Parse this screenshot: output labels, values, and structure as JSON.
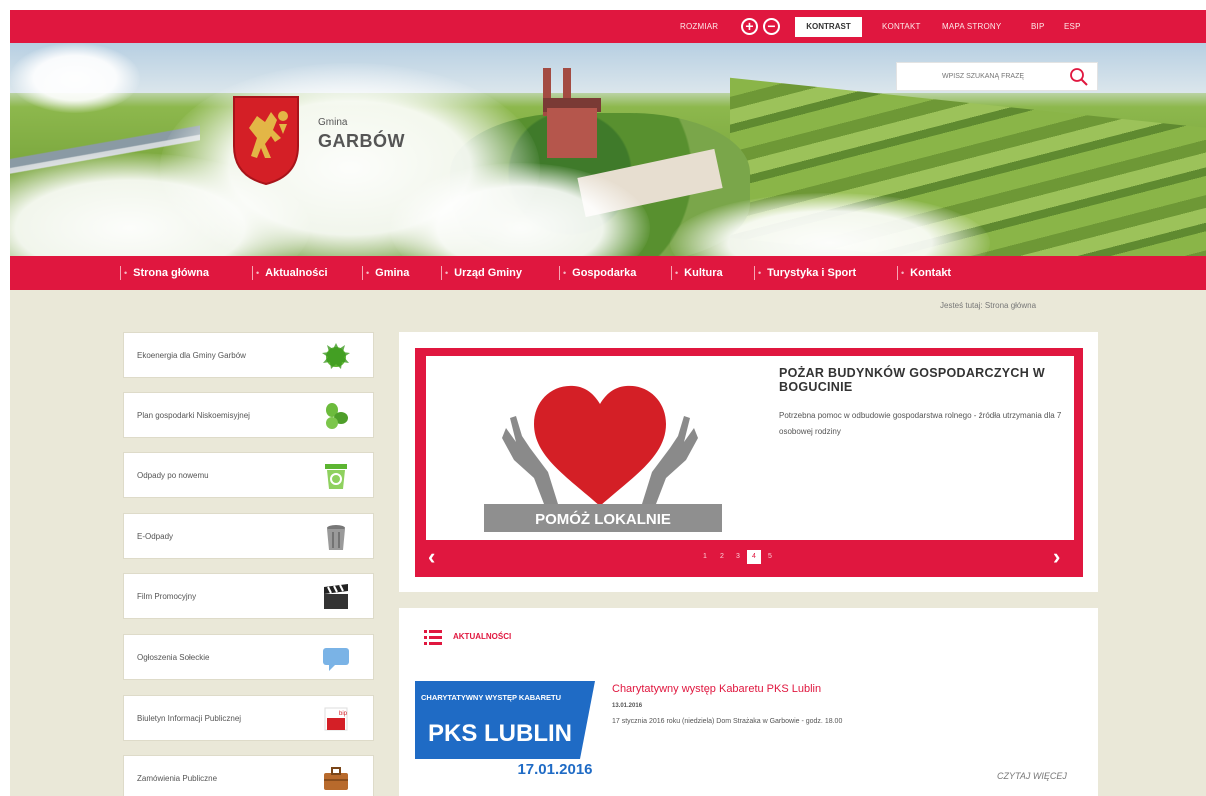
{
  "topbar": {
    "links": [
      "ROZMIAR",
      "KONTRAST",
      "KONTAKT",
      "MAPA STRONY",
      "BIP",
      "ESP"
    ]
  },
  "header": {
    "gmina_label": "Gmina",
    "gmina_name": "GARBÓW",
    "search_placeholder": "WPISZ SZUKANĄ FRAZĘ"
  },
  "nav": {
    "items": [
      "Strona główna",
      "Aktualności",
      "Gmina",
      "Urząd Gminy",
      "Gospodarka",
      "Kultura",
      "Turystyka i Sport",
      "Kontakt"
    ]
  },
  "breadcrumb": "Jesteś tutaj: Strona główna",
  "sidebar": {
    "items": [
      {
        "label": "Ekoenergia dla Gminy Garbów",
        "icon": "eco-globe-icon"
      },
      {
        "label": "Plan gospodarki Niskoemisyjnej",
        "icon": "leaves-icon"
      },
      {
        "label": "Odpady po nowemu",
        "icon": "recycle-bin-icon"
      },
      {
        "label": "E-Odpady",
        "icon": "trash-can-icon"
      },
      {
        "label": "Film Promocyjny",
        "icon": "clapperboard-icon"
      },
      {
        "label": "Ogłoszenia Sołeckie",
        "icon": "speech-bubble-icon"
      },
      {
        "label": "Biuletyn Informacji Publicznej",
        "icon": "bip-icon"
      },
      {
        "label": "Zamówienia Publiczne",
        "icon": "briefcase-icon"
      }
    ]
  },
  "slider": {
    "image_caption": "POMÓŻ LOKALNIE",
    "title": "POŻAR BUDYNKÓW GOSPODARCZYCH W BOGUCINIE",
    "description": "Potrzebna pomoc w odbudowie gospodarstwa rolnego - źródła utrzymania dla 7 osobowej rodziny",
    "pages": [
      "1",
      "2",
      "3",
      "4",
      "5"
    ],
    "active_page": 4,
    "prev": "‹",
    "next": "›"
  },
  "news": {
    "heading": "AKTUALNOŚCI",
    "image_top": "CHARYTATYWNY WYSTĘP KABARETU",
    "image_main": "PKS LUBLIN",
    "image_date": "17.01.2016",
    "title": "Charytatywny występ Kabaretu PKS Lublin",
    "date": "13.01.2016",
    "text": "17 stycznia 2016 roku (niedziela) Dom Strażaka w Garbowie - godz. 18.00",
    "more": "CZYTAJ WIĘCEJ"
  },
  "colors": {
    "accent": "#e0173f",
    "page_bg": "#eae8d8"
  }
}
